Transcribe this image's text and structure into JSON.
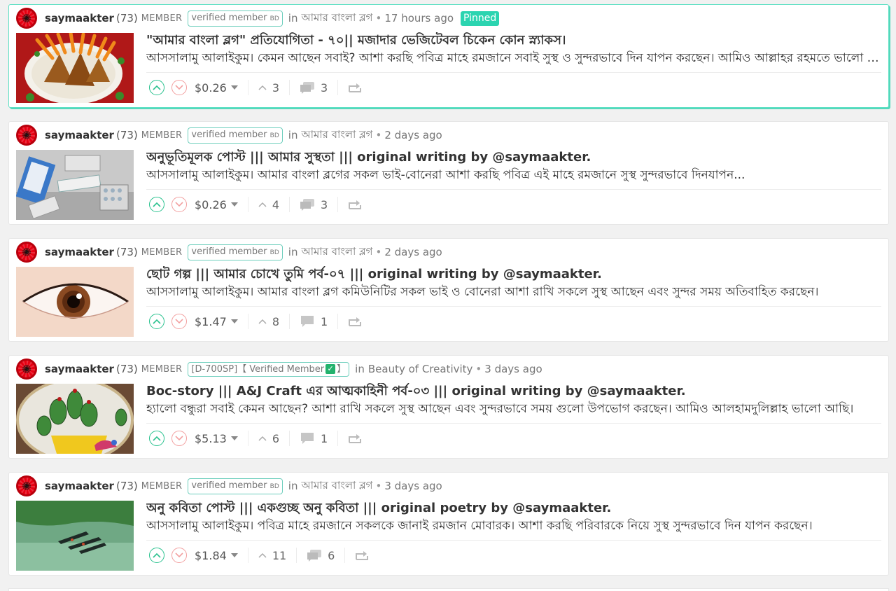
{
  "colors": {
    "accent": "#2bd4b0",
    "pinned_border": "#5ee0c4",
    "upvote": "#2bc28f",
    "downvote": "#f2a0a0",
    "tag_border": "#6fcfbd",
    "verified_check": "#23b26d"
  },
  "posts": [
    {
      "author": "saymaakter",
      "reputation": "(73)",
      "role": "MEMBER",
      "tag_main": "verified member",
      "tag_sub": "BD",
      "in_label": "in",
      "community": "আমার বাংলা ব্লগ",
      "time": "17 hours ago",
      "pinned_label": "Pinned",
      "title": "\"আমার বাংলা ব্লগ\" প্রতিযোগিতা - ৭০|| মজাদার ভেজিটেবল চিকেন কোন স্ন্যাকস।",
      "summary": "আসসালামু আলাইকুম। কেমন আছেন সবাই? আশা করছি পবিত্র মাহে রমজানে সবাই সুস্থ ও সুন্দরভাবে দিন যাপন করছেন। আমিও আল্লাহর রহমতে ভালো আছি।",
      "payout": "$0.26",
      "votes": "3",
      "comments": "3",
      "thumb_icon": "food-thumbnail"
    },
    {
      "author": "saymaakter",
      "reputation": "(73)",
      "role": "MEMBER",
      "tag_main": "verified member",
      "tag_sub": "BD",
      "in_label": "in",
      "community": "আমার বাংলা ব্লগ",
      "time": "2 days ago",
      "title": "অনুভূতিমূলক পোস্ট ||| আমার সুস্থতা ||| original writing by @saymaakter.",
      "summary": "আসসালামু আলাইকুম। আমার বাংলা ব্লগের সকল ভাই-বোনেরা আশা করছি পবিত্র এই মাহে রমজানে সুস্থ সুন্দরভাবে দিনযাপন...",
      "payout": "$0.26",
      "votes": "4",
      "comments": "3",
      "thumb_icon": "medicine-thumbnail"
    },
    {
      "author": "saymaakter",
      "reputation": "(73)",
      "role": "MEMBER",
      "tag_main": "verified member",
      "tag_sub": "BD",
      "in_label": "in",
      "community": "আমার বাংলা ব্লগ",
      "time": "2 days ago",
      "title": "ছোট গল্প ||| আমার চোখে তুমি পর্ব-০৭ ||| original writing by @saymaakter.",
      "summary": "আসসালামু আলাইকুম। আমার বাংলা ব্লগ কমিউনিটির সকল ভাই ও বোনেরা আশা রাখি সকলে সুস্থ আছেন এবং সুন্দর সময় অতিবাহিত করছেন।",
      "payout": "$1.47",
      "votes": "8",
      "comments": "1",
      "thumb_icon": "eye-thumbnail"
    },
    {
      "author": "saymaakter",
      "reputation": "(73)",
      "role": "MEMBER",
      "tag_alt_prefix": "[D-700SP]【 Verified Member",
      "tag_alt_suffix": "】",
      "check_glyph": "✓",
      "in_label": "in",
      "community": "Beauty of Creativity",
      "time": "3 days ago",
      "title": "Boc-story ||| A&J Craft এর আত্মকাহিনী পর্ব-০৩ ||| original writing by @saymaakter.",
      "summary": "হ্যালো বন্ধুরা সবাই কেমন আছেন? আশা রাখি সকলে সুস্থ আছেন এবং সুন্দরভাবে সময় গুলো উপভোগ করছেন। আমিও আলহামদুলিল্লাহ ভালো আছি।",
      "payout": "$5.13",
      "votes": "6",
      "comments": "1",
      "thumb_icon": "embroidery-thumbnail"
    },
    {
      "author": "saymaakter",
      "reputation": "(73)",
      "role": "MEMBER",
      "tag_main": "verified member",
      "tag_sub": "BD",
      "in_label": "in",
      "community": "আমার বাংলা ব্লগ",
      "time": "3 days ago",
      "title": "অনু কবিতা পোস্ট ||| একগুচ্ছ অনু কবিতা ||| original poetry by @saymaakter.",
      "summary": "আসসালামু আলাইকুম। পবিত্র মাহে রমজানে সকলকে জানাই রমজান মোবারক। আশা করছি পরিবারকে নিয়ে সুস্থ সুন্দরভাবে দিন যাপন করছেন।",
      "payout": "$1.84",
      "votes": "11",
      "comments": "6",
      "thumb_icon": "boats-thumbnail"
    }
  ]
}
